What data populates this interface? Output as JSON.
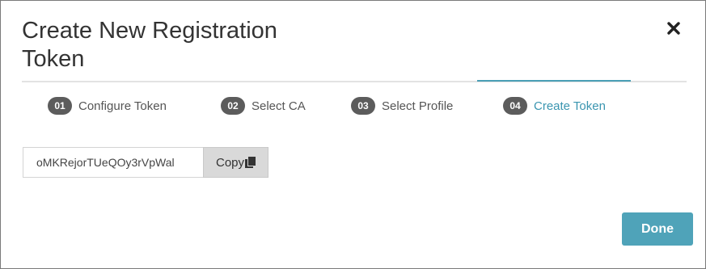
{
  "dialog": {
    "title": "Create New Registration Token",
    "close_icon": "close-icon"
  },
  "steps": [
    {
      "num": "01",
      "label": "Configure Token",
      "active": false
    },
    {
      "num": "02",
      "label": "Select CA",
      "active": false
    },
    {
      "num": "03",
      "label": "Select Profile",
      "active": false
    },
    {
      "num": "04",
      "label": "Create Token",
      "active": true
    }
  ],
  "token": {
    "value": "oMKRejorTUeQOy3rVpWal",
    "copy_label": "Copy",
    "copy_icon": "copy-icon"
  },
  "footer": {
    "done_label": "Done"
  },
  "colors": {
    "accent": "#4fa3b9",
    "active_step_text": "#3a95b0",
    "step_badge": "#5c5c5c"
  }
}
